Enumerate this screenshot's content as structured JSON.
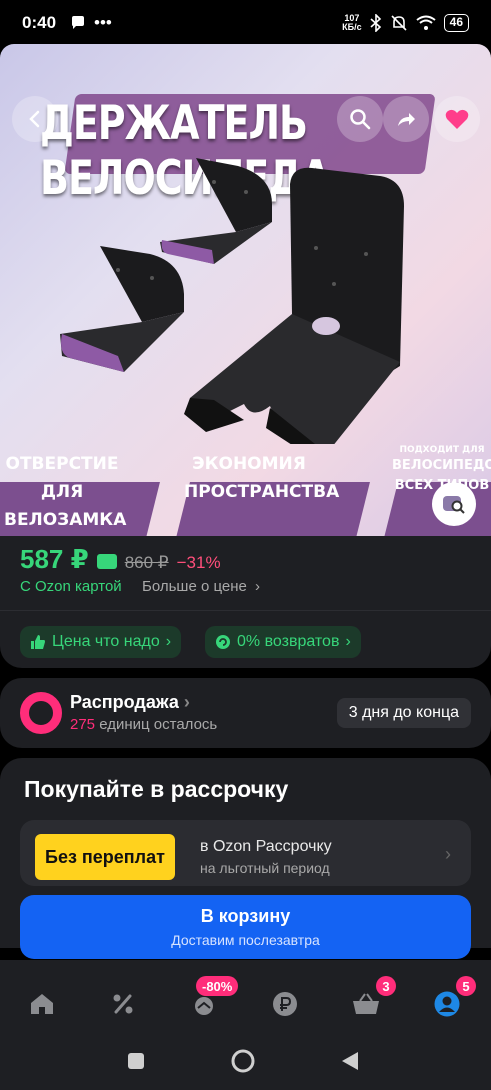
{
  "status_bar": {
    "time": "0:40",
    "net_speed_value": "107",
    "net_speed_unit": "КБ/с",
    "battery": "46"
  },
  "hero": {
    "title": "ДЕРЖАТЕЛЬ ВЕЛОСИПЕДА",
    "banners": [
      {
        "line1": "ОТВЕРСТИЕ ДЛЯ",
        "line2": "ВЕЛОЗАМКА"
      },
      {
        "line1": "ЭКОНОМИЯ",
        "line2": "ПРОСТРАНСТВА"
      },
      {
        "line1": "ПОДХОДИТ ДЛЯ",
        "line2": "ВЕЛОСИПЕДОВ",
        "line3": "ВСЕХ ТИПОВ"
      }
    ],
    "colors": {
      "accent": "#7c4f8f",
      "heart": "#ff3d8b"
    }
  },
  "price": {
    "current": "587 ₽",
    "old": "860 ₽",
    "discount": "−31%",
    "card_label": "С Ozon картой",
    "more_label": "Больше о цене",
    "color": "#37d67a"
  },
  "pills": [
    {
      "label": "Цена что надо",
      "icon": "thumbs-up-icon"
    },
    {
      "label": "0% возвратов",
      "icon": "return-icon"
    }
  ],
  "sale": {
    "title": "Распродажа",
    "count": "275",
    "remaining_label": "единиц осталось",
    "days": "3 дня до конца",
    "color": "#ff2d7a"
  },
  "installment": {
    "title": "Покупайте в рассрочку",
    "badge": "Без переплат",
    "line1": "в Ozon Рассрочку",
    "line2": "на льготный период"
  },
  "cart": {
    "label": "В корзину",
    "sublabel": "Доставим послезавтра",
    "color": "#1463f3"
  },
  "tabbar": {
    "items": [
      {
        "name": "home",
        "badge": ""
      },
      {
        "name": "discounts",
        "badge": ""
      },
      {
        "name": "fresh",
        "badge": "-80%"
      },
      {
        "name": "finance",
        "badge": ""
      },
      {
        "name": "cart",
        "badge": "3"
      },
      {
        "name": "profile",
        "badge": "5"
      }
    ]
  }
}
